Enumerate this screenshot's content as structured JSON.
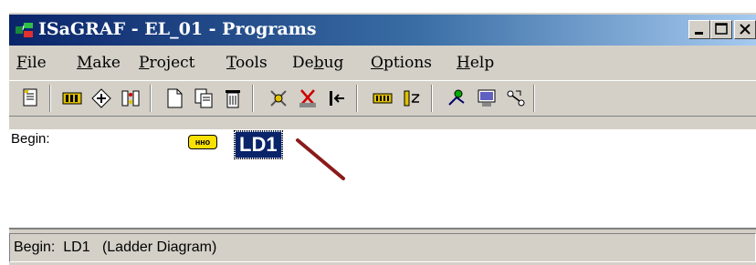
{
  "window": {
    "title": "ISaGRAF - EL_01 - Programs",
    "minimize_icon": "minimize-icon",
    "maximize_icon": "maximize-icon",
    "close_icon": "close-icon"
  },
  "menu": [
    {
      "label": "File",
      "underline": "F",
      "rest": "ile"
    },
    {
      "label": "Make",
      "underline": "M",
      "rest": "ake"
    },
    {
      "label": "Project",
      "underline": "P",
      "rest": "roject"
    },
    {
      "label": "Tools",
      "underline": "T",
      "rest": "ools"
    },
    {
      "label": "Debug",
      "pre": "De",
      "underline": "b",
      "rest": "ug"
    },
    {
      "label": "Options",
      "underline": "O",
      "rest": "ptions"
    },
    {
      "label": "Help",
      "underline": "H",
      "rest": "elp"
    }
  ],
  "toolbar": {
    "icons": [
      "edit-program-icon",
      "dictionary-icon",
      "connect-icon",
      "io-connection-icon",
      "new-program-icon",
      "copy-program-icon",
      "delete-program-icon",
      "compile-icon",
      "stop-icon",
      "link-icon",
      "io-board-icon",
      "simulate-icon",
      "debug-icon",
      "monitor-icon",
      "download-icon"
    ]
  },
  "programs": {
    "section_label": "Begin:",
    "ld_badge_text": "нно",
    "selected_program": "LD1"
  },
  "status": {
    "text": "Begin:  LD1   (Ladder Diagram)"
  },
  "colors": {
    "title_gradient_start": "#0a246a",
    "title_gradient_end": "#a6caf0",
    "selection": "#0a246a",
    "badge": "#f8e000",
    "arrow": "#8b1a1a"
  }
}
